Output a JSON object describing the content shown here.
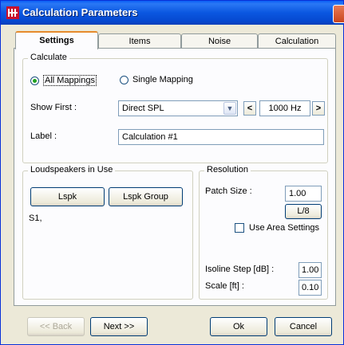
{
  "window": {
    "title": "Calculation Parameters"
  },
  "tabs": [
    {
      "label": "Settings",
      "active": true
    },
    {
      "label": "Items",
      "active": false
    },
    {
      "label": "Noise",
      "active": false
    },
    {
      "label": "Calculation",
      "active": false
    }
  ],
  "calculate": {
    "group_title": "Calculate",
    "radio_all": "All Mappings",
    "radio_single": "Single Mapping",
    "selected": "All Mappings",
    "show_first_label": "Show First :",
    "show_first_value": "Direct SPL",
    "freq_prev": "<",
    "freq_value": "1000 Hz",
    "freq_next": ">",
    "label_label": "Label :",
    "label_value": "Calculation #1"
  },
  "loudspeakers": {
    "group_title": "Loudspeakers in Use",
    "lspk_button": "Lspk",
    "lspk_group_button": "Lspk Group",
    "list_text": "S1,"
  },
  "resolution": {
    "group_title": "Resolution",
    "patch_size_label": "Patch Size :",
    "patch_size_value": "1.00",
    "l8_button": "L/8",
    "use_area_label": "Use Area Settings",
    "use_area_checked": false,
    "isoline_label": "Isoline Step [dB] :",
    "isoline_value": "1.00",
    "scale_label": "Scale [ft] :",
    "scale_value": "0.10"
  },
  "footer": {
    "back": "<< Back",
    "next": "Next >>",
    "ok": "Ok",
    "cancel": "Cancel"
  },
  "colors": {
    "titlebar": "#0a5ef5",
    "close": "#d9582c",
    "tab_accent": "#e68b2c",
    "radio_on": "#21a121"
  }
}
